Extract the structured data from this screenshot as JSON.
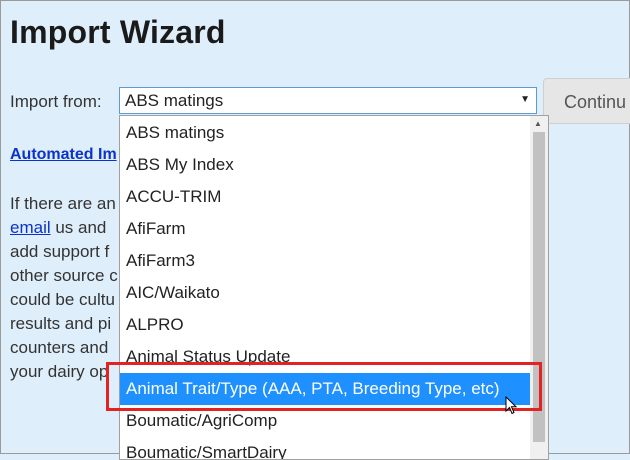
{
  "page": {
    "title": "Import Wizard",
    "import_label": "Import from:",
    "select_value": "ABS matings",
    "continue_label": "Continu",
    "automated_link": "Automated Im",
    "body_lines_prefix": [
      "If there are an",
      "",
      "add support f",
      "other source c",
      "could be cultu",
      "results and pi",
      "counters and",
      "your dairy op"
    ],
    "email_link": "email",
    "email_suffix": " us and"
  },
  "dropdown": {
    "options": [
      "ABS matings",
      "ABS My Index",
      "ACCU-TRIM",
      "AfiFarm",
      "AfiFarm3",
      "AIC/Waikato",
      "ALPRO",
      "Animal Status Update",
      "Animal Trait/Type (AAA, PTA, Breeding Type, etc)",
      "Boumatic/AgriComp",
      "Boumatic/SmartDairy"
    ],
    "selected_index": 8
  },
  "colors": {
    "background": "#dfeefb",
    "link": "#0b33cc",
    "selected_bg": "#1e90ff",
    "highlight_border": "#e32222"
  },
  "icons": {
    "select_arrow": "dropdown-arrow-icon",
    "cursor": "mouse-pointer-icon"
  }
}
